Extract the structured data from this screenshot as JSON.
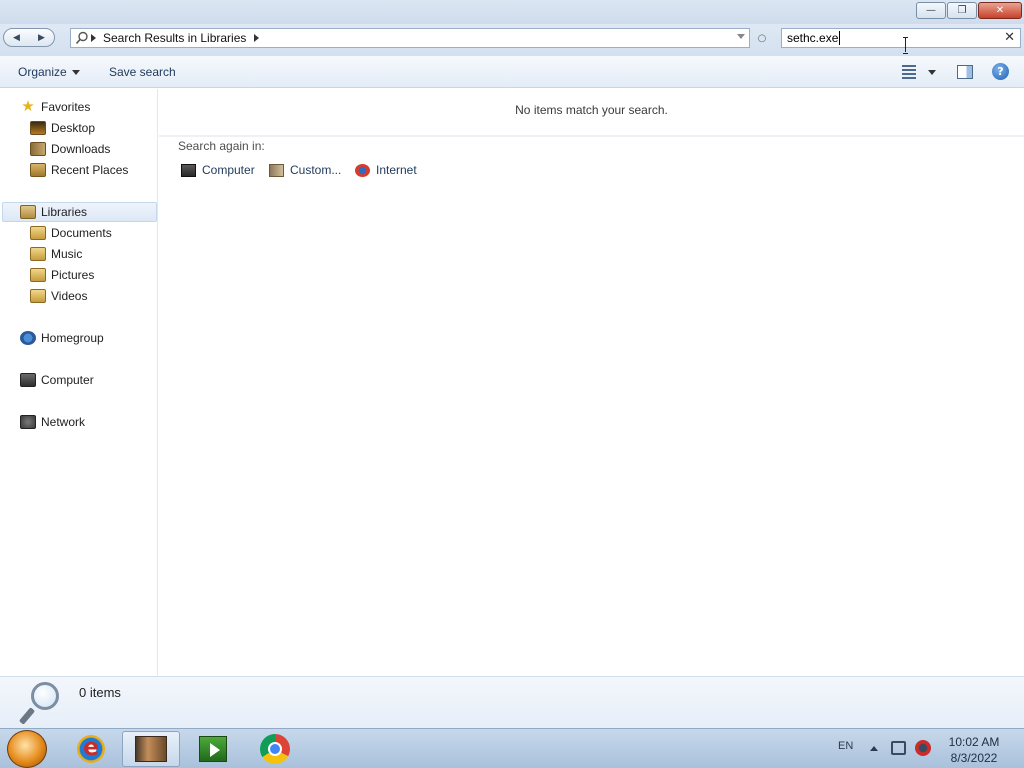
{
  "window": {
    "controls": {
      "minimize": "—",
      "maximize": "❐",
      "close": "✕"
    }
  },
  "address": {
    "breadcrumb": "Search Results in Libraries",
    "search_value": "sethc.exe"
  },
  "toolbar": {
    "organize_label": "Organize",
    "save_search_label": "Save search"
  },
  "nav": {
    "favorites": "Favorites",
    "favorites_items": [
      "Desktop",
      "Downloads",
      "Recent Places"
    ],
    "libraries": "Libraries",
    "libraries_items": [
      "Documents",
      "Music",
      "Pictures",
      "Videos"
    ],
    "homegroup": "Homegroup",
    "computer": "Computer",
    "network": "Network"
  },
  "content": {
    "empty_message": "No items match your search.",
    "search_again_label": "Search again in:",
    "search_again_items": [
      "Computer",
      "Custom...",
      "Internet"
    ]
  },
  "details": {
    "item_count": "0 items"
  },
  "taskbar": {
    "language": "EN",
    "time": "10:02 AM",
    "date": "8/3/2022"
  }
}
